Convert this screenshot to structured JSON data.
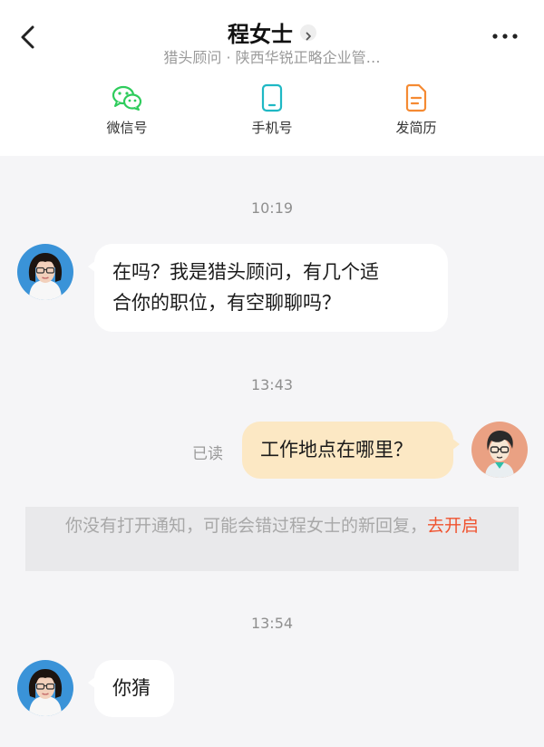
{
  "header": {
    "contact_name": "程女士",
    "contact_subtitle": "猎头顾问 · 陕西华锐正略企业管…",
    "actions": [
      {
        "label": "微信号",
        "icon": "wechat-icon",
        "color": "#2ecc5c"
      },
      {
        "label": "手机号",
        "icon": "phone-icon",
        "color": "#1fb8c4"
      },
      {
        "label": "发简历",
        "icon": "resume-icon",
        "color": "#f58a32"
      }
    ]
  },
  "messages": [
    {
      "time": "10:19",
      "from": "contact",
      "text_line1": "在吗？我是猎头顾问，有几个适",
      "text_line2": "合你的职位，有空聊聊吗？"
    },
    {
      "time": "13:43",
      "from": "me",
      "text": "工作地点在哪里？",
      "status": "已读"
    },
    {
      "time": "13:54",
      "from": "contact",
      "text": "你猜"
    }
  ],
  "notice": {
    "text": "你没有打开通知，可能会错过程女士的新回复，",
    "link_text": "去开启"
  },
  "colors": {
    "my_bubble": "#fce8c4",
    "notice_link": "#f0532f",
    "background": "#f5f5f7"
  }
}
